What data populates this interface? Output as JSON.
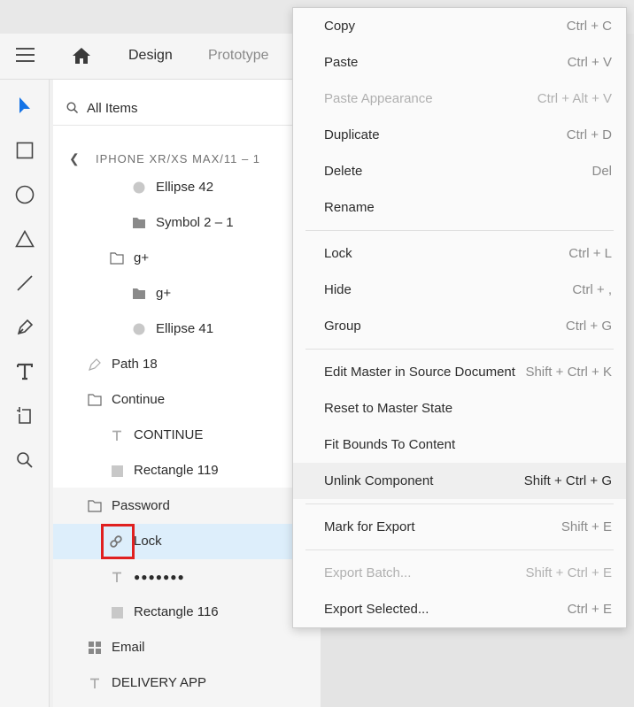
{
  "header": {
    "tabs": [
      "Design",
      "Prototype"
    ]
  },
  "search": {
    "placeholder": "All Items"
  },
  "breadcrumb": {
    "label": "IPHONE XR/XS MAX/11 – 1"
  },
  "layers": [
    {
      "label": "Ellipse 42",
      "icon": "ellipse-icon"
    },
    {
      "label": "Symbol 2 – 1",
      "icon": "folder-icon"
    },
    {
      "label": "g+",
      "icon": "folder-outline-icon"
    },
    {
      "label": "g+",
      "icon": "folder-icon"
    },
    {
      "label": "Ellipse 41",
      "icon": "ellipse-icon"
    },
    {
      "label": "Path 18",
      "icon": "pen-icon"
    },
    {
      "label": "Continue",
      "icon": "folder-outline-icon"
    },
    {
      "label": "CONTINUE",
      "icon": "text-icon"
    },
    {
      "label": "Rectangle 119",
      "icon": "rectangle-icon"
    },
    {
      "label": "Password",
      "icon": "folder-outline-icon"
    },
    {
      "label": "Lock",
      "icon": "link-icon"
    },
    {
      "label": "●●●●●●●",
      "icon": "text-icon"
    },
    {
      "label": "Rectangle 116",
      "icon": "rectangle-icon"
    },
    {
      "label": "Email",
      "icon": "repeat-grid-icon"
    },
    {
      "label": "DELIVERY APP",
      "icon": "text-icon"
    }
  ],
  "context_menu": {
    "items": [
      {
        "label": "Copy",
        "shortcut": "Ctrl + C"
      },
      {
        "label": "Paste",
        "shortcut": "Ctrl + V"
      },
      {
        "label": "Paste Appearance",
        "shortcut": "Ctrl + Alt + V"
      },
      {
        "label": "Duplicate",
        "shortcut": "Ctrl + D"
      },
      {
        "label": "Delete",
        "shortcut": "Del"
      },
      {
        "label": "Rename",
        "shortcut": ""
      },
      {
        "label": "Lock",
        "shortcut": "Ctrl + L"
      },
      {
        "label": "Hide",
        "shortcut": "Ctrl + ,"
      },
      {
        "label": "Group",
        "shortcut": "Ctrl + G"
      },
      {
        "label": "Edit Master in Source Document",
        "shortcut": "Shift + Ctrl + K"
      },
      {
        "label": "Reset to Master State",
        "shortcut": ""
      },
      {
        "label": "Fit Bounds To Content",
        "shortcut": ""
      },
      {
        "label": "Unlink Component",
        "shortcut": "Shift + Ctrl + G"
      },
      {
        "label": "Mark for Export",
        "shortcut": "Shift + E"
      },
      {
        "label": "Export Batch...",
        "shortcut": "Shift + Ctrl + E"
      },
      {
        "label": "Export Selected...",
        "shortcut": "Ctrl + E"
      }
    ]
  },
  "colors": {
    "accent": "#1473e6",
    "selection": "#ddeefb",
    "highlight_box": "#e02020"
  }
}
